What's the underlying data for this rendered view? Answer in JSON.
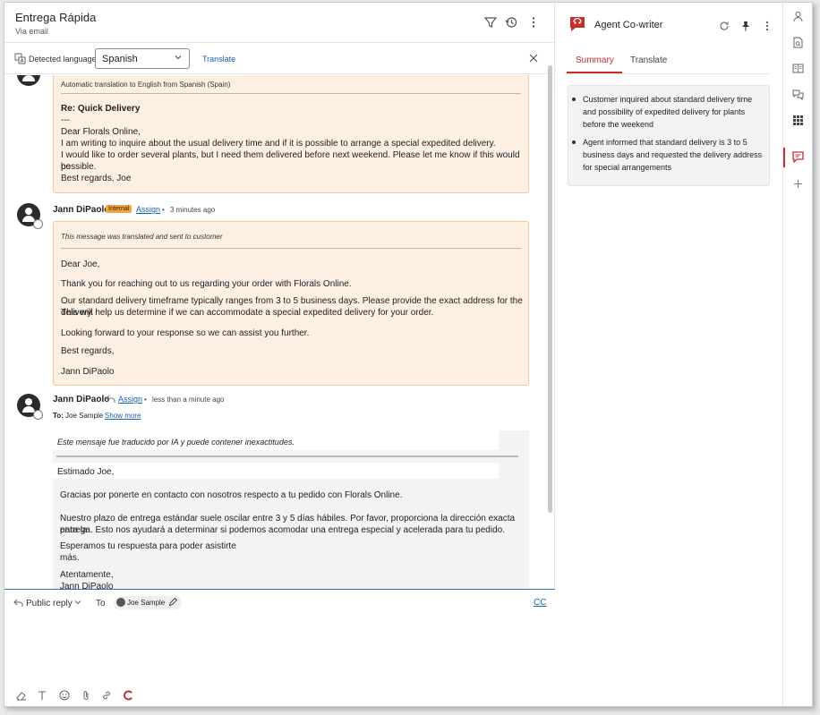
{
  "ticket": {
    "title": "Entrega Rápida",
    "channel": "Via email"
  },
  "header_icons": [
    "filter-icon",
    "history-icon",
    "more-vertical-icon"
  ],
  "language_bar": {
    "label": "Detected language",
    "selected_language": "Spanish",
    "translate_label": "Translate"
  },
  "message1": {
    "note": "Automatic translation to English from Spanish (Spain)",
    "subject": "Re: Quick Delivery",
    "separator": "---",
    "lines": [
      "Dear Florals Online,",
      "I am writing to inquire about the usual delivery time and if it is possible to arrange a special expedited delivery.",
      "I would like to order several plants, but I need them delivered before next weekend. Please let me know if this would be",
      "possible.",
      "Best regards, Joe"
    ]
  },
  "message2": {
    "author": "Jann DiPaolo",
    "badge": "Internal",
    "assign": "Assign",
    "dot": "•",
    "time": "3 minutes ago",
    "note": "This message was translated and sent to customer",
    "greeting": "Dear Joe,",
    "p1": "Thank you for reaching out to us regarding your order with Florals Online.",
    "p2a": "Our standard delivery timeframe typically ranges from 3 to 5 business days. Please provide the exact address for the delivery.",
    "p2b": "This will help us determine if we can accommodate a special expedited delivery for your order.",
    "p3": "Looking forward to your response so we can assist you further.",
    "closing": "Best regards,",
    "signature": "Jann DiPaolo"
  },
  "message3": {
    "author": "Jann DiPaolo",
    "assign": "Assign",
    "dot": "•",
    "time": "less than a minute ago",
    "to_label": "To:",
    "to_name": "Joe Sample",
    "show_more": "Show more",
    "note": "Este mensaje fue traducido por IA y puede contener inexactitudes.",
    "greeting": "Estimado Joe,",
    "p1": "Gracias por ponerte en contacto con nosotros respecto a tu pedido con Florals Online.",
    "p2a": "Nuestro plazo de entrega estándar suele oscilar entre 3 y 5 días hábiles. Por favor, proporciona la dirección exacta para la",
    "p2b": "entrega. Esto nos ayudará a determinar si podemos acomodar una entrega especial y acelerada para tu pedido.",
    "p3a": "Esperamos tu respuesta para poder asistirte",
    "p3b": "más.",
    "closing": "Atentamente,",
    "signature": "Jann DiPaolo"
  },
  "composer": {
    "mode": "Public reply",
    "to_label": "To",
    "recipient": "Joe Sample",
    "cc": "CC"
  },
  "copilot": {
    "title": "Agent Co-writer",
    "tabs": [
      "Summary",
      "Translate"
    ],
    "active_tab": "Summary",
    "summary": [
      "Customer inquired about standard delivery time and possibility of expedited delivery for plants before the weekend",
      "Agent informed that standard delivery is 3 to 5 business days and requested the delivery address for special arrangements"
    ]
  },
  "colors": {
    "accent": "#c5302d",
    "link": "#1a5fb4",
    "translated_bg": "#fdf0e2",
    "badge": "#f0a640"
  }
}
